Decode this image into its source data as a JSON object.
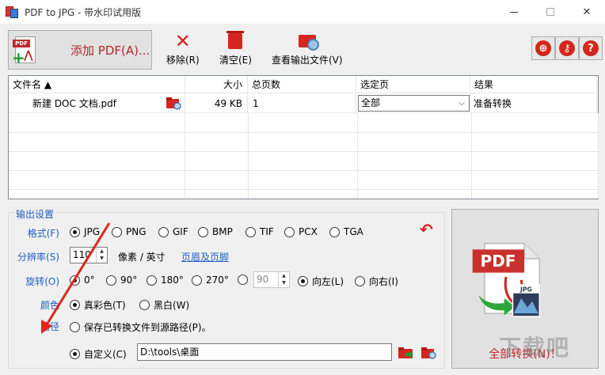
{
  "window": {
    "title": "PDF to JPG - 带水印试用版",
    "minimize": "—",
    "close": "✕"
  },
  "toolbar": {
    "add_pdf": "添加 PDF(A)...",
    "remove": "移除(R)",
    "clear": "清空(E)",
    "view_output": "查看输出文件(V)",
    "globe_icon": "globe-icon",
    "key_icon": "key-icon",
    "help_label": "?"
  },
  "file_list": {
    "headers": {
      "name": "文件名 ▲",
      "size": "大小",
      "pages": "总页数",
      "range": "选定页",
      "result": "结果"
    },
    "rows": [
      {
        "name": "新建 DOC 文档.pdf",
        "size": "49 KB",
        "pages": "1",
        "range": "全部",
        "result": "准备转换"
      }
    ]
  },
  "output_settings": {
    "title": "输出设置",
    "format_label": "格式(F)",
    "formats": [
      "JPG",
      "PNG",
      "GIF",
      "BMP",
      "TIF",
      "PCX",
      "TGA"
    ],
    "selected_format": "JPG",
    "resolution_label": "分辨率(S)",
    "resolution_value": "110",
    "resolution_unit": "像素 / 英寸",
    "header_footer_link": "页眉及页脚",
    "rotate_label": "旋转(O)",
    "rotations": [
      "0°",
      "90°",
      "180°",
      "270°"
    ],
    "selected_rotation": "0°",
    "custom_angle": "90",
    "rotate_left": "向左(L)",
    "rotate_right": "向右(I)",
    "selected_direction": "向左(L)",
    "color_label": "颜色",
    "color_true": "真彩色(T)",
    "color_bw": "黑白(W)",
    "selected_color": "真彩色(T)",
    "path_label": "路径",
    "path_source": "保存已转换文件到源路径(P)。",
    "path_custom": "自定义(C)",
    "path_value": "D:\\tools\\桌面",
    "selected_path": "自定义(C)"
  },
  "convert": {
    "label": "全部转换(N)！",
    "pdf_text": "PDF",
    "jpg_text": "JPG"
  },
  "watermark": "下载吧",
  "colors": {
    "accent_blue": "#1f5fbf",
    "brand_red": "#c0282d",
    "annotation_red": "#e0261f"
  }
}
